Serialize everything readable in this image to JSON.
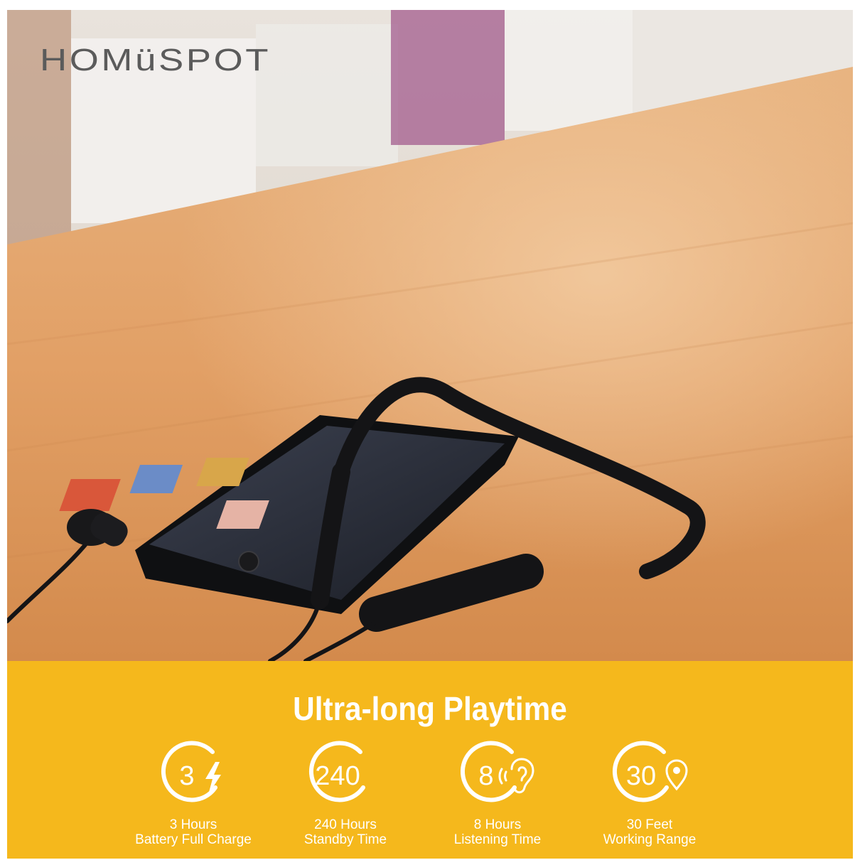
{
  "brand": {
    "logo_text": "HOMüSPOT"
  },
  "banner": {
    "title": "Ultra-long Playtime"
  },
  "features": [
    {
      "value": "3",
      "icon": "lightning-icon",
      "line1": "3 Hours",
      "line2": "Battery Full Charge"
    },
    {
      "value": "240",
      "icon": "moon-icon",
      "line1": "240 Hours",
      "line2": "Standby Time"
    },
    {
      "value": "8",
      "icon": "ear-icon",
      "line1": "8 Hours",
      "line2": "Listening Time"
    },
    {
      "value": "30",
      "icon": "location-pin-icon",
      "line1": "30 Feet",
      "line2": "Working Range"
    }
  ],
  "colors": {
    "banner": "#f5b81c",
    "text": "#ffffff",
    "table": "#e3a068"
  }
}
